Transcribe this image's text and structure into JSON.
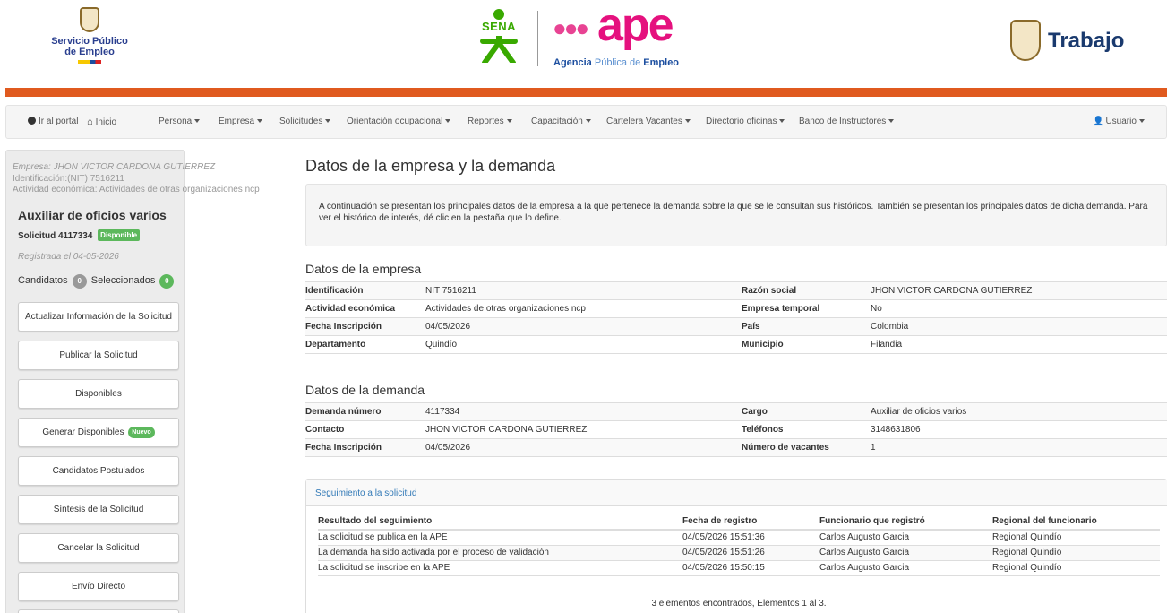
{
  "header": {
    "spe_logo_text": "Servicio Público de Empleo",
    "spe_line1": "Servicio Público",
    "spe_line2": "de Empleo",
    "sena_text": "SENA",
    "ape_text": "ape",
    "ape_sub_agencia": "Agencia",
    "ape_sub_publica": "Pública de",
    "ape_sub_empleo": "Empleo",
    "trabajo_text": "Trabajo"
  },
  "nav": {
    "items": [
      {
        "label": "Ir al portal"
      },
      {
        "label": "Inicio"
      },
      {
        "label": "Persona"
      },
      {
        "label": "Empresa"
      },
      {
        "label": "Solicitudes"
      },
      {
        "label": "Orientación ocupacional"
      },
      {
        "label": "Reportes"
      },
      {
        "label": "Capacitación"
      },
      {
        "label": "Cartelera Vacantes"
      },
      {
        "label": "Directorio oficinas"
      },
      {
        "label": "Banco de Instructores"
      }
    ],
    "user": "Usuario"
  },
  "sidebar": {
    "empresa": "Empresa: JHON VICTOR CARDONA GUTIERREZ",
    "identificacion": "Identificación:(NIT) 7516211",
    "actividad": "Actividad económica: Actividades de otras organizaciones ncp",
    "cargo": "Auxiliar de oficios varios",
    "solicitud": "Solicitud 4117334",
    "estado": "Disponible",
    "registrada": "Registrada el 04-05-2026",
    "candidatos_label": "Candidatos",
    "candidatos_count": "0",
    "seleccionados_label": "Seleccionados",
    "seleccionados_count": "0",
    "buttons": [
      {
        "label": "Actualizar Información de la Solicitud"
      },
      {
        "label": "Publicar la Solicitud"
      },
      {
        "label": "Disponibles"
      },
      {
        "label": "Generar Disponibles",
        "badge": "Nuevo"
      },
      {
        "label": "Candidatos Postulados"
      },
      {
        "label": "Síntesis de la Solicitud"
      },
      {
        "label": "Cancelar la Solicitud"
      },
      {
        "label": "Envío Directo"
      }
    ]
  },
  "main": {
    "title": "Datos de la empresa y la demanda",
    "info": "A continuación se presentan los principales datos de la empresa a la que pertenece la demanda sobre la que se le consultan sus históricos. También se presentan los principales datos de dicha demanda. Para ver el histórico de interés, dé clic en la pestaña que lo define.",
    "empresa_title": "Datos de la empresa",
    "empresa": [
      {
        "l1": "Identificación",
        "v1": "NIT 7516211",
        "l2": "Razón social",
        "v2": "JHON VICTOR CARDONA GUTIERREZ"
      },
      {
        "l1": "Actividad económica",
        "v1": "Actividades de otras organizaciones ncp",
        "l2": "Empresa temporal",
        "v2": "No"
      },
      {
        "l1": "Fecha Inscripción",
        "v1": "04/05/2026",
        "l2": "País",
        "v2": "Colombia"
      },
      {
        "l1": "Departamento",
        "v1": "Quindío",
        "l2": "Municipio",
        "v2": "Filandia"
      }
    ],
    "demanda_title": "Datos de la demanda",
    "demanda": [
      {
        "l1": "Demanda número",
        "v1": "4117334",
        "l2": "Cargo",
        "v2": "Auxiliar de oficios varios"
      },
      {
        "l1": "Contacto",
        "v1": "JHON VICTOR CARDONA GUTIERREZ",
        "l2": "Teléfonos",
        "v2": "3148631806"
      },
      {
        "l1": "Fecha Inscripción",
        "v1": "04/05/2026",
        "l2": "Número de vacantes",
        "v2": "1"
      }
    ],
    "seguimiento": {
      "link": "Seguimiento a la solicitud",
      "headers": [
        "Resultado del seguimiento",
        "Fecha de registro",
        "Funcionario que registró",
        "Regional del funcionario"
      ],
      "rows": [
        [
          "La solicitud se publica en la APE",
          "04/05/2026 15:51:36",
          "Carlos Augusto Garcia",
          "Regional Quindío"
        ],
        [
          "La demanda ha sido activada por el proceso de validación",
          "04/05/2026 15:51:26",
          "Carlos Augusto Garcia",
          "Regional Quindío"
        ],
        [
          "La solicitud se inscribe en la APE",
          "04/05/2026 15:50:15",
          "Carlos Augusto Garcia",
          "Regional Quindío"
        ]
      ],
      "footer": "3 elementos encontrados, Elementos 1 al 3."
    }
  },
  "colors": {
    "accent_orange": "#e05a1f",
    "success_green": "#5cb85c",
    "link_blue": "#337ab7"
  }
}
